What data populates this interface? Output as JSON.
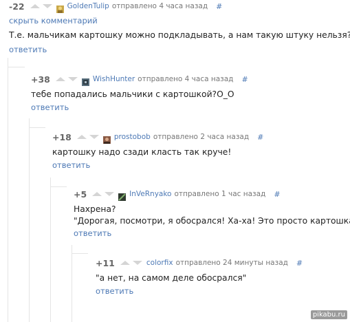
{
  "comments": [
    {
      "rating": "-22",
      "username": "GoldenTulip",
      "sent": "отправлено 4 часа назад",
      "hash": "#",
      "hide_label": "скрыть комментарий",
      "lines": [
        "Т.е. мальчикам картошку можно подкладывать, а нам такую штуку нельзя?"
      ],
      "reply_label": "ответить",
      "avatar_color": "#c9a84a"
    },
    {
      "rating": "+38",
      "username": "WishHunter",
      "sent": "отправлено 4 часа назад",
      "hash": "#",
      "lines": [
        "тебе попадались мальчики с картошкой?O_O"
      ],
      "reply_label": "ответить",
      "avatar_color": "#556b7a"
    },
    {
      "rating": "+18",
      "username": "prostobob",
      "sent": "отправлено 2 часа назад",
      "hash": "#",
      "lines": [
        "картошку надо сзади класть так круче!"
      ],
      "reply_label": "ответить",
      "avatar_color": "#8a5a44"
    },
    {
      "rating": "+5",
      "username": "InVeRnyako",
      "sent": "отправлено 1 час назад",
      "hash": "#",
      "lines": [
        "Нахрена?",
        "\"Дорогая, посмотри, я обосрался! Ха-ха! Это просто картошка\""
      ],
      "reply_label": "ответить",
      "avatar_color": "#2f3a2f"
    },
    {
      "rating": "+11",
      "username": "colorfix",
      "sent": "отправлено 24 минуты назад",
      "hash": "#",
      "lines": [
        "\"а нет, на самом деле обосрался\""
      ],
      "reply_label": "ответить"
    }
  ],
  "watermark": "pikabu.ru",
  "colors": {
    "link": "#4d79b5",
    "text": "#222222",
    "muted": "#777777",
    "vote_arrow": "#d5d5d5",
    "thread_line": "#e4e4e4"
  }
}
